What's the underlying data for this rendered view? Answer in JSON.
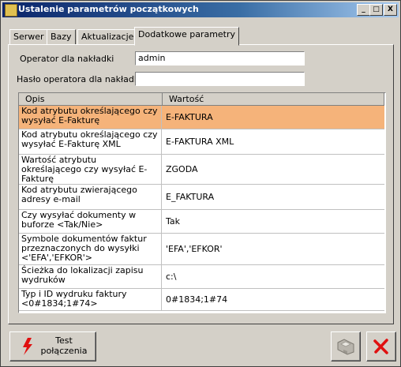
{
  "window": {
    "title": "Ustalenie parametrów początkowych",
    "min_label": "_",
    "max_label": "□",
    "close_label": "X"
  },
  "tabs": [
    {
      "label": "Serwer",
      "active": false
    },
    {
      "label": "Bazy",
      "active": false
    },
    {
      "label": "Aktualizacje",
      "active": false
    },
    {
      "label": "Dodatkowe parametry",
      "active": true
    }
  ],
  "form": {
    "operator_label": "Operator dla nakładki",
    "operator_value": "admin",
    "password_label": "Hasło operatora dla nakładki",
    "password_value": ""
  },
  "grid": {
    "headers": [
      "Opis",
      "Wartość"
    ],
    "rows": [
      {
        "desc": "Kod atrybutu określającego czy wysyłać E-Fakturę",
        "value": "E-FAKTURA",
        "selected": true
      },
      {
        "desc": "Kod atrybutu określającego czy wysyłać E-Fakturę XML",
        "value": "E-FAKTURA XML",
        "selected": false
      },
      {
        "desc": "Wartość atrybutu określającego czy wysyłać E-Fakturę",
        "value": "ZGODA",
        "selected": false
      },
      {
        "desc": "Kod atrybutu zwierającego adresy e-mail",
        "value": "E_FAKTURA",
        "selected": false
      },
      {
        "desc": "Czy wysyłać dokumenty w buforze <Tak/Nie>",
        "value": "Tak",
        "selected": false
      },
      {
        "desc": "Symbole dokumentów faktur przeznaczonych do wysyłki <'EFA','EFKOR'>",
        "value": "'EFA','EFKOR'",
        "selected": false
      },
      {
        "desc": "Ścieżka do lokalizacji zapisu wydruków",
        "value": "c:\\",
        "selected": false
      },
      {
        "desc": "Typ i ID wydruku faktury <0#1834;1#74>",
        "value": "0#1834;1#74",
        "selected": false
      }
    ]
  },
  "buttons": {
    "test_line1": "Test",
    "test_line2": "połączenia"
  },
  "colors": {
    "selected_row": "#f5b37a",
    "title_start": "#0a246a",
    "title_end": "#a6caf0"
  }
}
